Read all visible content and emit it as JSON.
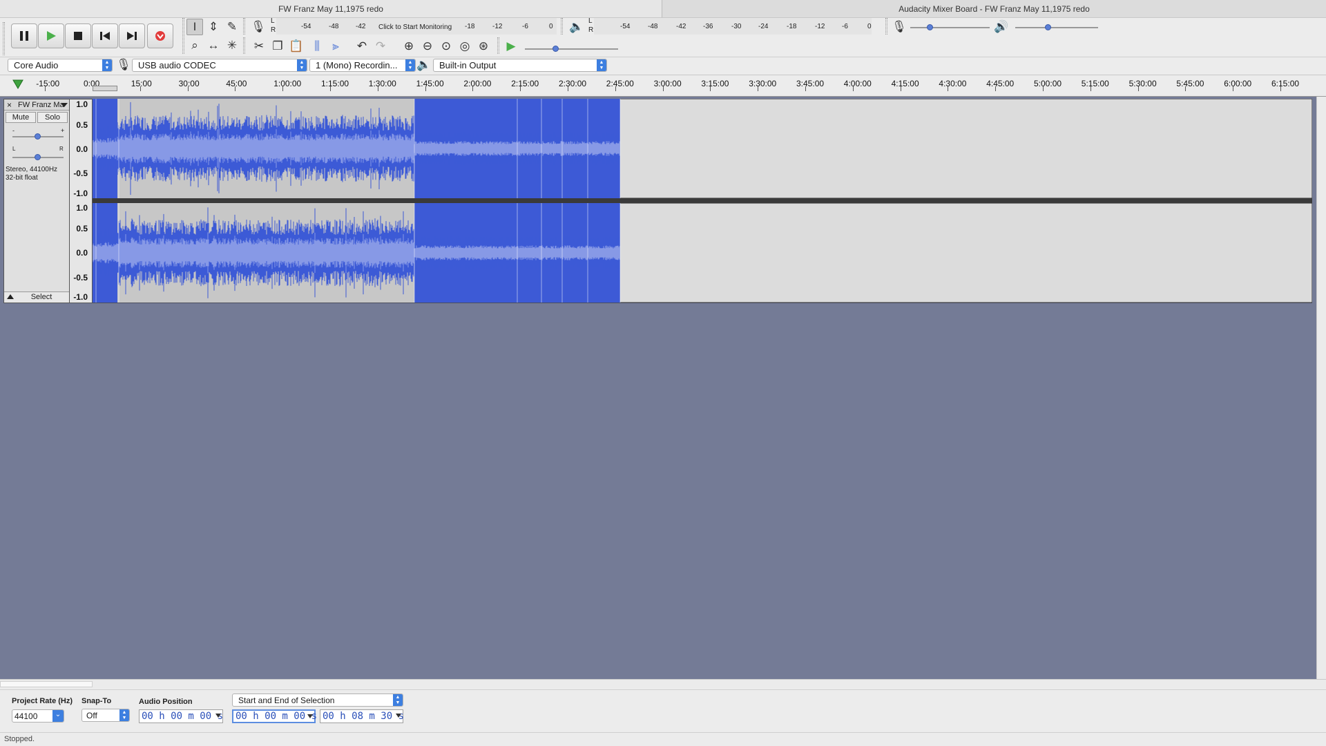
{
  "windows": {
    "main_title": "FW Franz May 11,1975 redo",
    "mixer_title": "Audacity Mixer Board - FW Franz May 11,1975 redo"
  },
  "meters": {
    "record_lr": [
      "L",
      "R"
    ],
    "record_ticks": [
      "-54",
      "-48",
      "-42"
    ],
    "monitor_prompt": "Click to Start Monitoring",
    "record_ticks_after": [
      "-18",
      "-12",
      "-6",
      "0"
    ],
    "play_lr": [
      "L",
      "R"
    ],
    "play_ticks": [
      "-54",
      "-48",
      "-42",
      "-36",
      "-30",
      "-24",
      "-18",
      "-12",
      "-6",
      "0"
    ]
  },
  "devices": {
    "host": "Core Audio",
    "recording_device": "USB audio CODEC",
    "recording_channels": "1 (Mono) Recordin...",
    "playback_device": "Built-in Output"
  },
  "timeline": {
    "ticks": [
      "-15:00",
      "0:00",
      "15:00",
      "30:00",
      "45:00",
      "1:00:00",
      "1:15:00",
      "1:30:00",
      "1:45:00",
      "2:00:00",
      "2:15:00",
      "2:30:00",
      "2:45:00",
      "3:00:00",
      "3:15:00",
      "3:30:00",
      "3:45:00",
      "4:00:00",
      "4:15:00",
      "4:30:00",
      "4:45:00",
      "5:00:00",
      "5:15:00",
      "5:30:00",
      "5:45:00",
      "6:00:00",
      "6:15:00"
    ]
  },
  "track": {
    "close_symbol": "×",
    "name": "FW Franz Ma",
    "mute_label": "Mute",
    "solo_label": "Solo",
    "gain_minus": "-",
    "gain_plus": "+",
    "pan_left": "L",
    "pan_right": "R",
    "format_line1": "Stereo, 44100Hz",
    "format_line2": "32-bit float",
    "select_label": "Select",
    "scale_ticks": [
      "1.0",
      "0.5",
      "0.0",
      "-0.5",
      "-1.0"
    ]
  },
  "selection_bar": {
    "project_rate_label": "Project Rate (Hz)",
    "project_rate_value": "44100",
    "snap_to_label": "Snap-To",
    "snap_to_value": "Off",
    "audio_position_label": "Audio Position",
    "audio_position_value": "00 h 00 m 00 s",
    "selection_mode": "Start and End of Selection",
    "selection_start": "00 h 00 m 00 s",
    "selection_end": "00 h 08 m 30 s"
  },
  "status": {
    "text": "Stopped."
  },
  "colors": {
    "background": "#747b96",
    "wave_unselected_bg": "#c7c7c7",
    "wave_selected_bg": "#3d5ad6",
    "wave_color": "#3c5ad6",
    "wave_rms": "#8799e6",
    "empty_track": "#dcdcdc"
  }
}
